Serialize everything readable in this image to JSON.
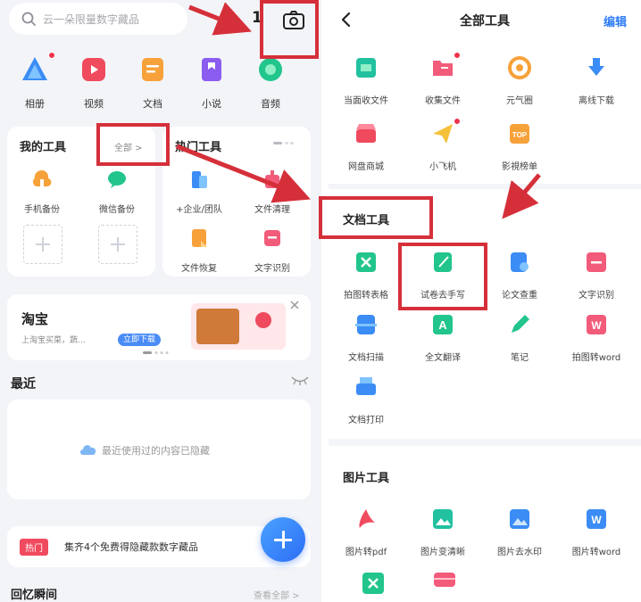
{
  "left": {
    "search_placeholder": "云一朵限量数字藏品",
    "notification_count": "1",
    "categories": [
      {
        "label": "相册",
        "icon": "photo-icon",
        "color": "#3b8cf4"
      },
      {
        "label": "视频",
        "icon": "video-icon",
        "color": "#f04a5e"
      },
      {
        "label": "文档",
        "icon": "document-icon",
        "color": "#f7a13a"
      },
      {
        "label": "小说",
        "icon": "book-icon",
        "color": "#8a5cf0"
      },
      {
        "label": "音频",
        "icon": "audio-icon",
        "color": "#22c58b"
      }
    ],
    "my_tools": {
      "title": "我的工具",
      "all_label": "全部 >",
      "items": [
        {
          "label": "手机备份",
          "icon": "phone-backup-icon"
        },
        {
          "label": "微信备份",
          "icon": "wechat-backup-icon"
        }
      ]
    },
    "hot_tools": {
      "title": "热门工具",
      "items": [
        {
          "label": "+企业/团队",
          "icon": "enterprise-icon"
        },
        {
          "label": "文件清理",
          "icon": "file-clean-icon"
        },
        {
          "label": "文件恢复",
          "icon": "file-restore-icon"
        },
        {
          "label": "文字识别",
          "icon": "ocr-icon"
        }
      ]
    },
    "ad": {
      "title": "淘宝",
      "desc": "上淘宝买菜，蔬...",
      "button": "立即下载"
    },
    "recent": {
      "title": "最近",
      "hidden_text": "最近使用过的内容已隐藏"
    },
    "promo": {
      "tag": "热门",
      "text": "集齐4个免费得隐藏款数字藏品"
    },
    "memories": {
      "title": "回忆瞬间",
      "link": "查看全部 >"
    }
  },
  "right": {
    "title": "全部工具",
    "edit": "编辑",
    "top_tools": [
      {
        "label": "当面收文件",
        "icon": "receive-file-icon",
        "color": "#22c1a0"
      },
      {
        "label": "收集文件",
        "icon": "collect-file-icon",
        "color": "#f25b7a"
      },
      {
        "label": "元气圈",
        "icon": "vitality-icon",
        "color": "#f7a13a"
      },
      {
        "label": "离线下载",
        "icon": "offline-download-icon",
        "color": "#3b8cf4"
      },
      {
        "label": "网盘商城",
        "icon": "store-icon",
        "color": "#f04a5e"
      },
      {
        "label": "小飞机",
        "icon": "paper-plane-icon",
        "color": "#f5c13a"
      },
      {
        "label": "影視榜单",
        "icon": "top-chart-icon",
        "color": "#f7a13a"
      }
    ],
    "doc_tools": {
      "title": "文档工具",
      "items": [
        {
          "label": "拍图转表格",
          "icon": "photo-to-excel-icon",
          "color": "#22c58b"
        },
        {
          "label": "试卷去手写",
          "icon": "remove-handwriting-icon",
          "color": "#22c58b"
        },
        {
          "label": "论文查重",
          "icon": "thesis-check-icon",
          "color": "#3b8cf4"
        },
        {
          "label": "文字识别",
          "icon": "ocr-icon",
          "color": "#f25b7a"
        },
        {
          "label": "文档扫描",
          "icon": "doc-scan-icon",
          "color": "#3b8cf4"
        },
        {
          "label": "全文翻译",
          "icon": "translate-icon",
          "color": "#22c58b"
        },
        {
          "label": "笔记",
          "icon": "note-icon",
          "color": "#22c58b"
        },
        {
          "label": "拍图转word",
          "icon": "photo-to-word-icon",
          "color": "#f25b7a"
        },
        {
          "label": "文档打印",
          "icon": "print-icon",
          "color": "#3b8cf4"
        }
      ]
    },
    "image_tools": {
      "title": "图片工具",
      "items": [
        {
          "label": "图片转pdf",
          "icon": "image-to-pdf-icon",
          "color": "#f04a5e"
        },
        {
          "label": "图片变清晰",
          "icon": "image-enhance-icon",
          "color": "#22c1a0"
        },
        {
          "label": "图片去水印",
          "icon": "remove-watermark-icon",
          "color": "#3b8cf4"
        },
        {
          "label": "图片转word",
          "icon": "image-to-word-icon",
          "color": "#3b8cf4"
        }
      ]
    }
  },
  "colors": {
    "highlight": "#d5303a",
    "accent": "#2f7df6",
    "tag": "#f04a5e"
  }
}
